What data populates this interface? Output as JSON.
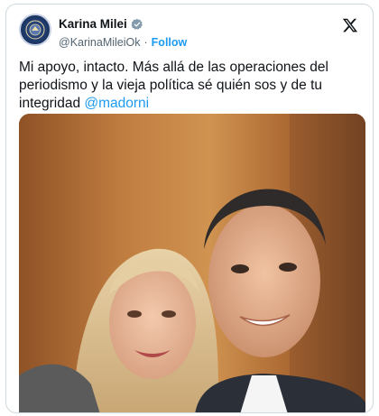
{
  "tweet": {
    "author": {
      "display_name": "Karina Milei",
      "handle": "@KarinaMileiOk",
      "follow_label": "Follow",
      "separator": "·",
      "avatar_icon": "presidential-seal-icon",
      "verified_icon": "verified-badge-icon"
    },
    "platform_icon": "x-logo-icon",
    "text": "Mi apoyo, intacto. Más allá de las operaciones del periodismo y la vieja política sé quién sos y de tu integridad ",
    "mention": "@madorni",
    "media": {
      "type": "photo",
      "icon": "selfie-photo"
    }
  },
  "colors": {
    "accent": "#1d9bf0",
    "text": "#0f1419",
    "secondary": "#536471",
    "border": "#cfd9de"
  }
}
